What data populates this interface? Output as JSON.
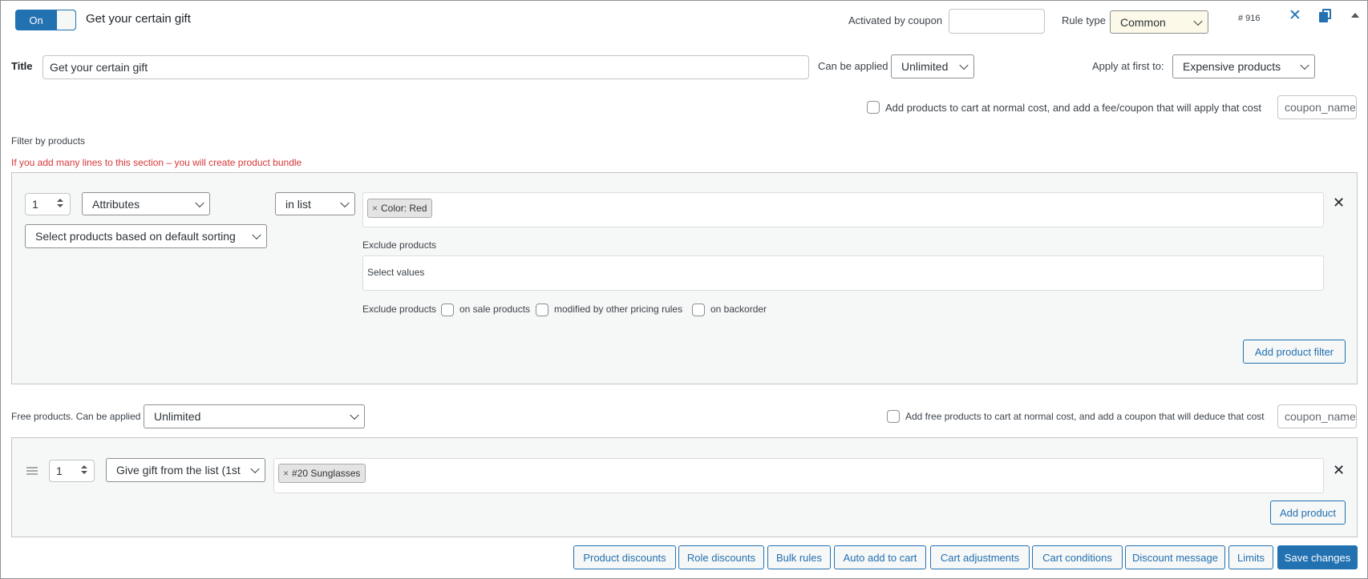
{
  "header": {
    "toggle_label": "On",
    "rule_name": "Get your certain gift",
    "activated_by_coupon_label": "Activated by coupon",
    "activated_by_coupon_value": "",
    "rule_type_label": "Rule type",
    "rule_type_value": "Common",
    "rule_id": "# 916"
  },
  "title_row": {
    "title_label": "Title",
    "title_value": "Get your certain gift",
    "can_be_applied_label": "Can be applied",
    "can_be_applied_value": "Unlimited",
    "apply_first_label": "Apply at first to:",
    "apply_first_value": "Expensive products"
  },
  "normal_cost": {
    "label": "Add products to cart at normal cost, and add a fee/coupon that will apply that cost",
    "coupon_placeholder": "coupon_name"
  },
  "filter": {
    "section_label": "Filter by products",
    "warning": "If you add many lines to this section – you will create product bundle",
    "qty": "1",
    "type": "Attributes",
    "condition": "in list",
    "sorting": "Select products based on default sorting",
    "tags": [
      "Color: Red"
    ],
    "exclude_label": "Exclude products",
    "exclude_placeholder": "Select values",
    "exclude_options_label": "Exclude products",
    "exclude_on_sale": "on sale products",
    "exclude_modified": "modified by other pricing rules",
    "exclude_backorder": "on backorder",
    "add_button": "Add product filter"
  },
  "free": {
    "label": "Free products. Can be applied",
    "applied_value": "Unlimited",
    "normal_cost_label": "Add free products to cart at normal cost, and add a coupon that will deduce that cost",
    "coupon_placeholder": "coupon_name",
    "qty": "1",
    "gift_type": "Give gift from the list (1st",
    "tags": [
      "#20 Sunglasses"
    ],
    "add_button": "Add product"
  },
  "footer": {
    "buttons": [
      "Product discounts",
      "Role discounts",
      "Bulk rules",
      "Auto add to cart",
      "Cart adjustments",
      "Cart conditions",
      "Discount message",
      "Limits"
    ],
    "save_label": "Save changes"
  },
  "colors": {
    "accent": "#2271b1",
    "warning": "#d63638",
    "rule_type_bg": "#fcf9e8"
  }
}
